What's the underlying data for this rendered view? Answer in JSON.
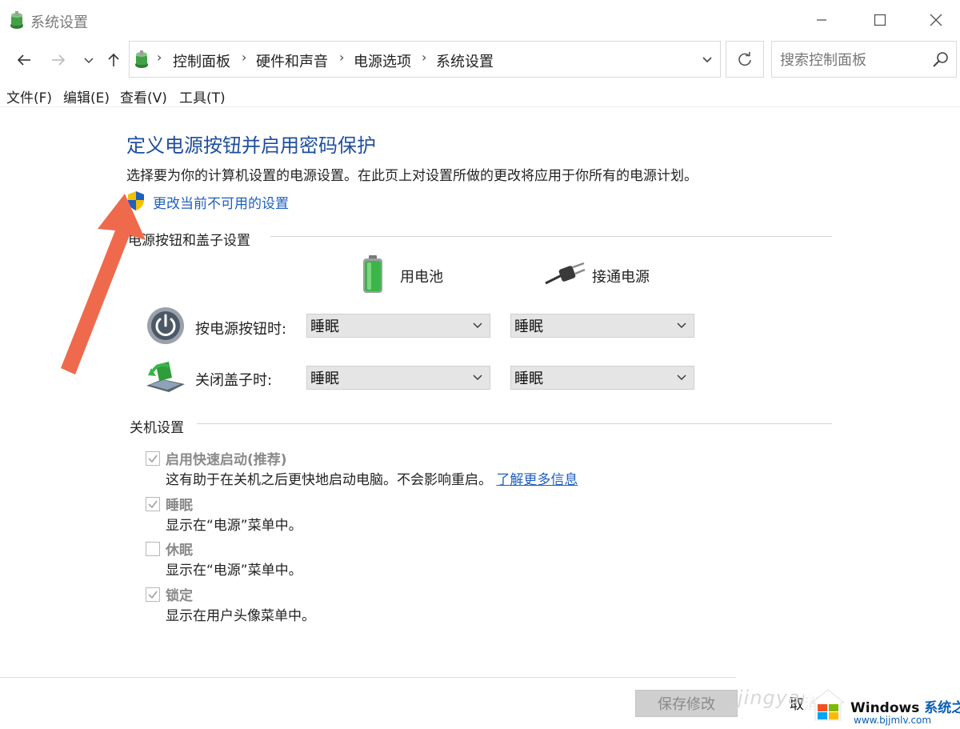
{
  "window": {
    "title": "系统设置",
    "icon": "control-panel-icon"
  },
  "nav": {
    "breadcrumb": [
      "控制面板",
      "硬件和声音",
      "电源选项",
      "系统设置"
    ],
    "search_placeholder": "搜索控制面板"
  },
  "menu": [
    "文件(F)",
    "编辑(E)",
    "查看(V)",
    "工具(T)"
  ],
  "content": {
    "title": "定义电源按钮并启用密码保护",
    "description": "选择要为你的计算机设置的电源设置。在此页上对设置所做的更改将应用于你所有的电源计划。",
    "change_link": "更改当前不可用的设置",
    "power_section": {
      "title": "电源按钮和盖子设置",
      "col_battery": "用电池",
      "col_plugged": "接通电源",
      "rows": [
        {
          "label": "按电源按钮时:",
          "battery": "睡眠",
          "plugged": "睡眠",
          "icon": "power-button-icon"
        },
        {
          "label": "关闭盖子时:",
          "battery": "睡眠",
          "plugged": "睡眠",
          "icon": "laptop-lid-icon"
        }
      ]
    },
    "shutdown_section": {
      "title": "关机设置",
      "items": [
        {
          "label": "启用快速启动(推荐)",
          "checked": true,
          "desc": "这有助于在关机之后更快地启动电脑。不会影响重启。",
          "link": "了解更多信息"
        },
        {
          "label": "睡眠",
          "checked": true,
          "desc": "显示在“电源”菜单中。"
        },
        {
          "label": "休眠",
          "checked": false,
          "desc": "显示在“电源”菜单中。"
        },
        {
          "label": "锁定",
          "checked": true,
          "desc": "显示在用户头像菜单中。"
        }
      ]
    }
  },
  "buttons": {
    "save": "保存修改",
    "cancel": "取消"
  },
  "overlay": {
    "watermark_site": "jingyan",
    "badge_windows": "Windows",
    "badge_suffix": "系统之家",
    "badge_url": "www.bjjmlv.com"
  },
  "colors": {
    "title_blue": "#1f4e9c",
    "link_blue": "#1f5fbf",
    "arrow_red": "#ef6a4c",
    "battery_green": "#3bb54a"
  }
}
